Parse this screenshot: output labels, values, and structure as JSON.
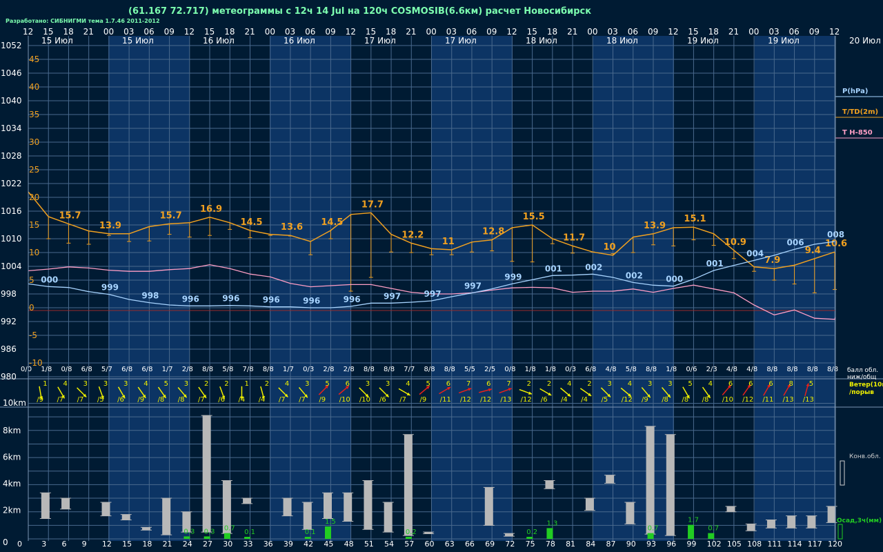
{
  "header": {
    "title": "(61.167 72.717) метеограммы с  12ч 14 Jul на 120ч COSMOSIB(6.6км) расчет Новосибирск",
    "developer": "Разработано: СИБНИГМИ тема 1.7.46 2011-2012"
  },
  "colors": {
    "bg": "#001b33",
    "band_light": "#0c3464",
    "grid": "#4a6a8e",
    "pressure": "#a8d4ff",
    "temperature": "#f0a020",
    "t850": "#ff9ec4",
    "wind_yellow": "#f0f000",
    "wind_red": "#e8201a",
    "cloud_bar": "#b8b8b8",
    "precip": "#22cc22",
    "text": "#ffffff"
  },
  "chart_data": {
    "type": "meteogram",
    "top_hours": [
      "12",
      "15",
      "18",
      "21",
      "00",
      "03",
      "06",
      "09",
      "12",
      "15",
      "18",
      "21",
      "00",
      "03",
      "06",
      "09",
      "12",
      "15",
      "18",
      "21",
      "00",
      "03",
      "06",
      "09",
      "12",
      "15",
      "18",
      "21",
      "00",
      "03",
      "06",
      "09",
      "12",
      "15",
      "18",
      "21",
      "00",
      "03",
      "06",
      "09",
      "12"
    ],
    "day_labels": [
      "15 Июл",
      "15 Июл",
      "16 Июл",
      "16 Июл",
      "17 Июл",
      "17 Июл",
      "18 Июл",
      "18 Июл",
      "19 Июл",
      "19 Июл"
    ],
    "right_day_label": "20 Июл",
    "pressure_axis": [
      "1052",
      "1046",
      "1040",
      "1034",
      "1028",
      "1022",
      "1016",
      "1010",
      "1004",
      "998",
      "992",
      "986",
      "980"
    ],
    "temp_axis": [
      "45",
      "40",
      "35",
      "30",
      "25",
      "20",
      "15",
      "10",
      "5",
      "0",
      "-5",
      "-10"
    ],
    "legend": {
      "pressure": "P(hPa)",
      "temperature": "T/TD(2m)",
      "t850": "T H-850"
    },
    "pressure_hpa": [
      1000.2,
      999.6,
      999.4,
      998.5,
      997.9,
      996.8,
      996.1,
      995.6,
      995.4,
      995.4,
      995.5,
      995.4,
      995.2,
      995.2,
      995.0,
      995.0,
      995.3,
      996.0,
      996.0,
      996.2,
      996.5,
      997.4,
      998.2,
      999.1,
      1000.2,
      1001.1,
      1002.0,
      1002.1,
      1002.3,
      1001.6,
      1000.5,
      999.9,
      999.7,
      1001.2,
      1003.1,
      1004.2,
      1005.3,
      1006.4,
      1007.7,
      1008.8,
      1009.4
    ],
    "pressure_labels": [
      {
        "i": 1,
        "text": "000"
      },
      {
        "i": 4,
        "text": "999"
      },
      {
        "i": 6,
        "text": "998"
      },
      {
        "i": 8,
        "text": "996"
      },
      {
        "i": 10,
        "text": "996"
      },
      {
        "i": 12,
        "text": "996"
      },
      {
        "i": 14,
        "text": "996"
      },
      {
        "i": 16,
        "text": "996"
      },
      {
        "i": 18,
        "text": "997"
      },
      {
        "i": 20,
        "text": "997"
      },
      {
        "i": 22,
        "text": "997"
      },
      {
        "i": 24,
        "text": "999"
      },
      {
        "i": 26,
        "text": "001"
      },
      {
        "i": 28,
        "text": "002"
      },
      {
        "i": 30,
        "text": "002"
      },
      {
        "i": 32,
        "text": "000"
      },
      {
        "i": 34,
        "text": "001"
      },
      {
        "i": 36,
        "text": "004"
      },
      {
        "i": 38,
        "text": "006"
      },
      {
        "i": 40,
        "text": "008"
      }
    ],
    "temperature_c": [
      21.5,
      17.0,
      15.7,
      14.4,
      13.9,
      13.9,
      15.2,
      15.7,
      15.9,
      16.9,
      15.9,
      14.5,
      13.8,
      13.6,
      12.5,
      14.5,
      17.4,
      17.7,
      13.8,
      12.2,
      11.2,
      11.0,
      12.4,
      12.8,
      15.0,
      15.5,
      13.0,
      11.7,
      10.6,
      10.0,
      13.3,
      13.9,
      15.0,
      15.1,
      13.9,
      10.9,
      7.9,
      7.6,
      8.2,
      9.4,
      10.6
    ],
    "temperature_low_c": [
      21.5,
      13.0,
      12.2,
      12.0,
      13.6,
      12.5,
      12.6,
      13.8,
      13.3,
      13.6,
      14.7,
      13.2,
      13.6,
      13.5,
      10.1,
      13.0,
      3.5,
      6.0,
      10.6,
      10.5,
      10.1,
      10.1,
      10.6,
      10.8,
      8.9,
      8.8,
      12.1,
      10.4,
      10.6,
      10.3,
      10.5,
      11.9,
      11.7,
      12.8,
      11.8,
      9.4,
      7.1,
      5.5,
      4.8,
      3.2,
      3.8
    ],
    "temperature_labels": [
      {
        "i": 2,
        "text": "15.7"
      },
      {
        "i": 4,
        "text": "13.9"
      },
      {
        "i": 7,
        "text": "15.7"
      },
      {
        "i": 9,
        "text": "16.9"
      },
      {
        "i": 11,
        "text": "14.5"
      },
      {
        "i": 13,
        "text": "13.6"
      },
      {
        "i": 15,
        "text": "14.5"
      },
      {
        "i": 17,
        "text": "17.7"
      },
      {
        "i": 19,
        "text": "12.2"
      },
      {
        "i": 21,
        "text": "11"
      },
      {
        "i": 23,
        "text": "12.8"
      },
      {
        "i": 25,
        "text": "15.5"
      },
      {
        "i": 27,
        "text": "11.7"
      },
      {
        "i": 29,
        "text": "10"
      },
      {
        "i": 31,
        "text": "13.9"
      },
      {
        "i": 33,
        "text": "15.1"
      },
      {
        "i": 35,
        "text": "10.9"
      },
      {
        "i": 37,
        "text": "7.9"
      },
      {
        "i": 39,
        "text": "9.4"
      },
      {
        "i": 40,
        "text": "10.6"
      }
    ],
    "t850_c": [
      7.2,
      7.5,
      7.9,
      7.7,
      7.3,
      7.1,
      7.1,
      7.4,
      7.6,
      8.3,
      7.6,
      6.6,
      6.1,
      4.9,
      4.3,
      4.5,
      4.7,
      4.7,
      4.0,
      3.3,
      3.0,
      3.0,
      3.2,
      3.7,
      4.1,
      4.2,
      4.1,
      3.3,
      3.5,
      3.5,
      3.9,
      3.3,
      4.0,
      4.6,
      3.9,
      3.2,
      1.0,
      -0.8,
      0.1,
      -1.4,
      -1.6,
      -1.2
    ],
    "clouds": [
      "0/0",
      "1/8",
      "0/8",
      "6/8",
      "5/7",
      "6/8",
      "6/8",
      "1/7",
      "2/8",
      "8/8",
      "5/8",
      "7/8",
      "8/8",
      "1/7",
      "0/3",
      "2/8",
      "2/8",
      "8/8",
      "8/8",
      "7/7",
      "8/8",
      "8/8",
      "5/5",
      "2/5",
      "0/8",
      "1/8",
      "1/8",
      "0/3",
      "6/8",
      "4/8",
      "5/8",
      "8/8",
      "1/8",
      "0/6",
      "2/3",
      "4/8",
      "4/8",
      "8/8",
      "8/8",
      "8/8",
      "8/8"
    ],
    "cloud_label": [
      "балл обл.",
      "ниж/общ"
    ],
    "wind_speed": [
      "1",
      "4",
      "3",
      "3",
      "3",
      "4",
      "5",
      "3",
      "2",
      "2",
      "1",
      "2",
      "4",
      "3",
      "5",
      "6",
      "3",
      "3",
      "4",
      "5",
      "6",
      "7",
      "6",
      "7",
      "2",
      "2",
      "4",
      "2",
      "3",
      "4",
      "3",
      "3",
      "5",
      "4",
      "6",
      "6",
      "6",
      "8",
      "5"
    ],
    "wind_gust": [
      "/9",
      "/7",
      "/7",
      "/5",
      "/6",
      "/9",
      "/8",
      "/8",
      "/7",
      "/6",
      "/4",
      "/4",
      "/7",
      "/7",
      "/9",
      "/10",
      "/10",
      "/6",
      "/7",
      "/9",
      "/11",
      "/12",
      "/12",
      "/13",
      "/12",
      "/6",
      "/4",
      "/4",
      "/5",
      "/12",
      "/9",
      "/8",
      "/8",
      "/8",
      "/10",
      "/12",
      "/11",
      "/13",
      "/13"
    ],
    "wind_dir_deg": [
      80,
      60,
      45,
      70,
      60,
      55,
      55,
      50,
      55,
      70,
      90,
      75,
      45,
      50,
      -45,
      -40,
      45,
      45,
      30,
      -40,
      -30,
      -20,
      -15,
      -20,
      20,
      30,
      40,
      35,
      45,
      40,
      50,
      50,
      60,
      55,
      -50,
      -55,
      -60,
      -60,
      -75
    ],
    "wind_red": [
      false,
      false,
      false,
      false,
      false,
      false,
      false,
      false,
      false,
      false,
      false,
      false,
      false,
      false,
      true,
      true,
      false,
      false,
      false,
      true,
      true,
      true,
      true,
      true,
      false,
      false,
      false,
      false,
      false,
      false,
      false,
      false,
      false,
      false,
      true,
      true,
      true,
      true,
      true
    ],
    "wind_label": [
      "Ветер(10м)",
      "/порыв"
    ],
    "height_axis": [
      "10km",
      "8km",
      "6km",
      "4km",
      "2km",
      "0"
    ],
    "conv_label": "Конв.обл.",
    "precip_label": "Осад,3ч(мм)",
    "lead_hours": [
      "3",
      "6",
      "9",
      "12",
      "15",
      "18",
      "21",
      "24",
      "27",
      "30",
      "33",
      "36",
      "39",
      "42",
      "45",
      "48",
      "51",
      "54",
      "57",
      "60",
      "63",
      "66",
      "69",
      "72",
      "75",
      "78",
      "81",
      "84",
      "87",
      "90",
      "93",
      "96",
      "99",
      "102",
      "105",
      "108",
      "111",
      "114",
      "117",
      "120"
    ],
    "conv_clouds_km": [
      [
        0.85,
        1.5,
        3.4
      ],
      [
        1.85,
        2.2,
        3.0
      ],
      [
        3.85,
        1.7,
        2.7
      ],
      [
        4.85,
        1.4,
        1.8
      ],
      [
        5.85,
        0.65,
        0.85
      ],
      [
        6.85,
        0.3,
        3.0
      ],
      [
        7.85,
        0.5,
        2.0
      ],
      [
        8.85,
        0.5,
        9.1
      ],
      [
        9.85,
        0.4,
        4.3
      ],
      [
        10.85,
        2.6,
        3.0
      ],
      [
        12.85,
        1.7,
        3.0
      ],
      [
        13.85,
        0.7,
        2.7
      ],
      [
        14.85,
        1.5,
        3.4
      ],
      [
        15.85,
        1.3,
        3.4
      ],
      [
        16.85,
        0.7,
        4.3
      ],
      [
        17.85,
        0.5,
        2.7
      ],
      [
        18.85,
        0.25,
        7.7
      ],
      [
        19.85,
        0.38,
        0.5
      ],
      [
        22.85,
        1.0,
        3.8
      ],
      [
        23.85,
        0.2,
        0.4
      ],
      [
        25.85,
        3.7,
        4.3
      ],
      [
        27.85,
        2.1,
        3.0
      ],
      [
        28.85,
        4.1,
        4.7
      ],
      [
        29.85,
        1.1,
        2.7
      ],
      [
        30.85,
        0.35,
        8.3
      ],
      [
        31.85,
        0.25,
        7.7
      ],
      [
        34.85,
        2.0,
        2.4
      ],
      [
        35.85,
        0.6,
        1.1
      ],
      [
        36.85,
        0.8,
        1.4
      ],
      [
        37.85,
        0.8,
        1.7
      ],
      [
        38.85,
        0.8,
        1.7
      ],
      [
        39.85,
        1.2,
        2.4
      ]
    ],
    "precip_mm": [
      {
        "i": 7,
        "value": 0.3,
        "text": "0.3"
      },
      {
        "i": 8,
        "value": 0.3,
        "text": "0.3"
      },
      {
        "i": 9,
        "value": 0.7,
        "text": "0.7"
      },
      {
        "i": 10,
        "value": 0.1,
        "text": "0.1"
      },
      {
        "i": 13,
        "value": 0.1,
        "text": "0.1"
      },
      {
        "i": 14,
        "value": 1.5,
        "text": "1.5"
      },
      {
        "i": 18,
        "value": 0.2,
        "text": "0.2"
      },
      {
        "i": 24,
        "value": 0.2,
        "text": "0.2"
      },
      {
        "i": 25,
        "value": 1.3,
        "text": "1.3"
      },
      {
        "i": 30,
        "value": 0.7,
        "text": "0.7"
      },
      {
        "i": 32,
        "value": 1.7,
        "text": "1.7"
      },
      {
        "i": 33,
        "value": 0.7,
        "text": "0.7"
      }
    ]
  }
}
